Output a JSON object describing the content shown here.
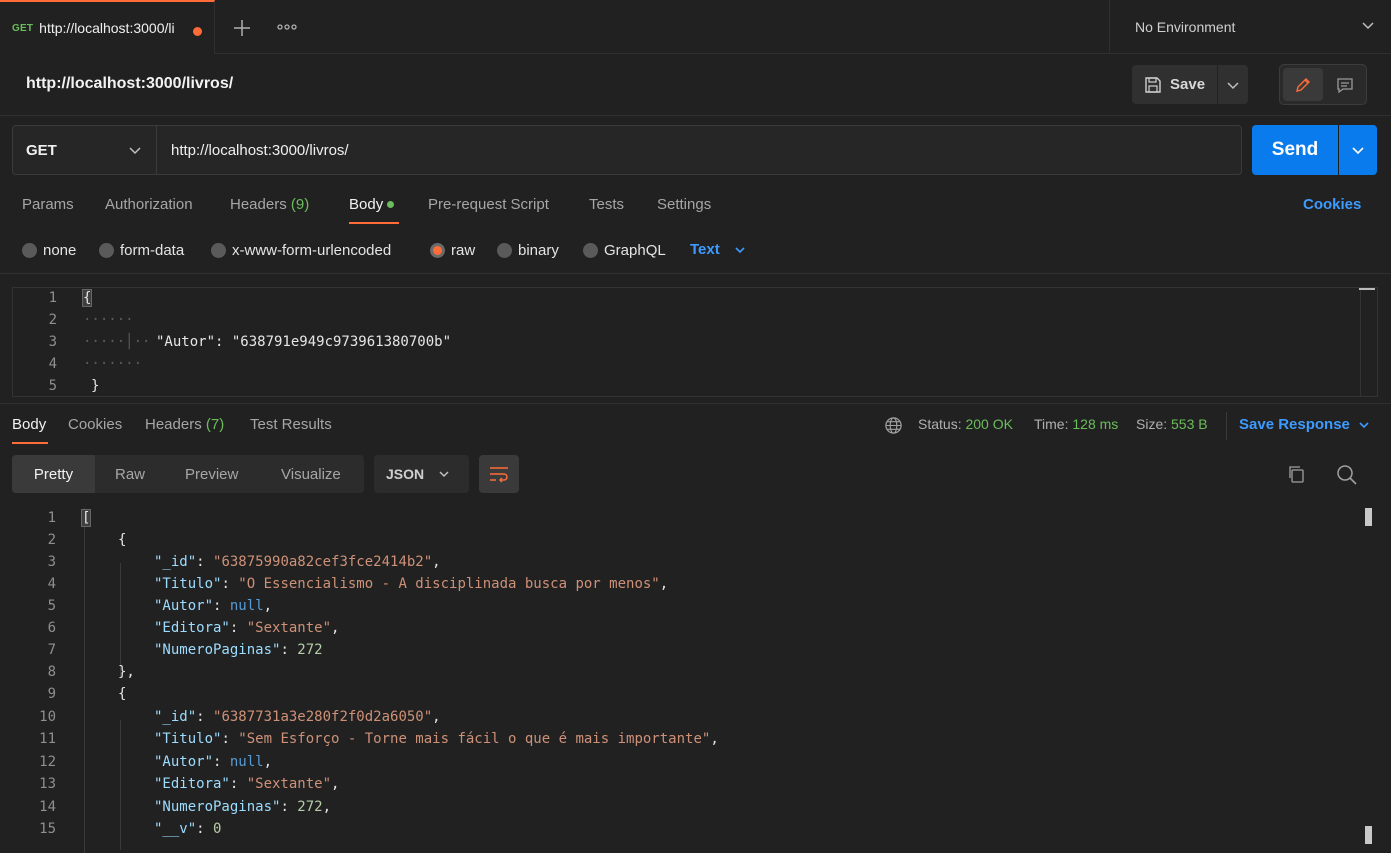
{
  "tabs": {
    "active": {
      "method": "GET",
      "title": "http://localhost:3000/li"
    },
    "add_label": "+",
    "more_label": "∘∘∘"
  },
  "environment": {
    "label": "No Environment"
  },
  "request": {
    "name": "http://localhost:3000/livros/",
    "method": "GET",
    "url": "http://localhost:3000/livros/",
    "save_label": "Save",
    "send_label": "Send"
  },
  "request_tabs": {
    "params": "Params",
    "authorization": "Authorization",
    "headers": "Headers",
    "headers_count": "(9)",
    "body": "Body",
    "prerequest": "Pre-request Script",
    "tests": "Tests",
    "settings": "Settings",
    "cookies": "Cookies"
  },
  "body_types": {
    "none": "none",
    "form_data": "form-data",
    "urlencoded": "x-www-form-urlencoded",
    "raw": "raw",
    "binary": "binary",
    "graphql": "GraphQL",
    "format": "Text",
    "selected": "raw"
  },
  "request_body": {
    "lines": [
      {
        "num": "1",
        "text": "{"
      },
      {
        "num": "2",
        "text": ""
      },
      {
        "num": "3",
        "text": "\"Autor\": \"638791e949c973961380700b\""
      },
      {
        "num": "4",
        "text": ""
      },
      {
        "num": "5",
        "text": "}"
      }
    ]
  },
  "response_tabs": {
    "body": "Body",
    "cookies": "Cookies",
    "headers": "Headers",
    "headers_count": "(7)",
    "test_results": "Test Results"
  },
  "response_meta": {
    "status_label": "Status:",
    "status": "200 OK",
    "time_label": "Time:",
    "time": "128 ms",
    "size_label": "Size:",
    "size": "553 B",
    "save_response": "Save Response"
  },
  "response_view": {
    "pretty": "Pretty",
    "raw": "Raw",
    "preview": "Preview",
    "visualize": "Visualize",
    "format": "JSON"
  },
  "response_body": {
    "line_numbers": [
      "1",
      "2",
      "3",
      "4",
      "5",
      "6",
      "7",
      "8",
      "9",
      "10",
      "11",
      "12",
      "13",
      "14",
      "15"
    ],
    "items": [
      {
        "_id": "\"63875990a82cef3fce2414b2\"",
        "Titulo": "\"O Essencialismo - A disciplinada busca por menos\"",
        "Autor": "null",
        "Editora": "\"Sextante\"",
        "NumeroPaginas": "272"
      },
      {
        "_id": "\"6387731a3e280f2f0d2a6050\"",
        "Titulo": "\"Sem Esforço - Torne mais fácil o que é mais importante\"",
        "Autor": "null",
        "Editora": "\"Sextante\"",
        "NumeroPaginas": "272",
        "__v": "0"
      }
    ]
  },
  "colors": {
    "accent": "#ff6c37",
    "send": "#097bed",
    "link": "#3d9bff",
    "success": "#6bbd5b",
    "json_key": "#9cdcfe",
    "json_string": "#ce9178",
    "json_number": "#b5cea8"
  }
}
